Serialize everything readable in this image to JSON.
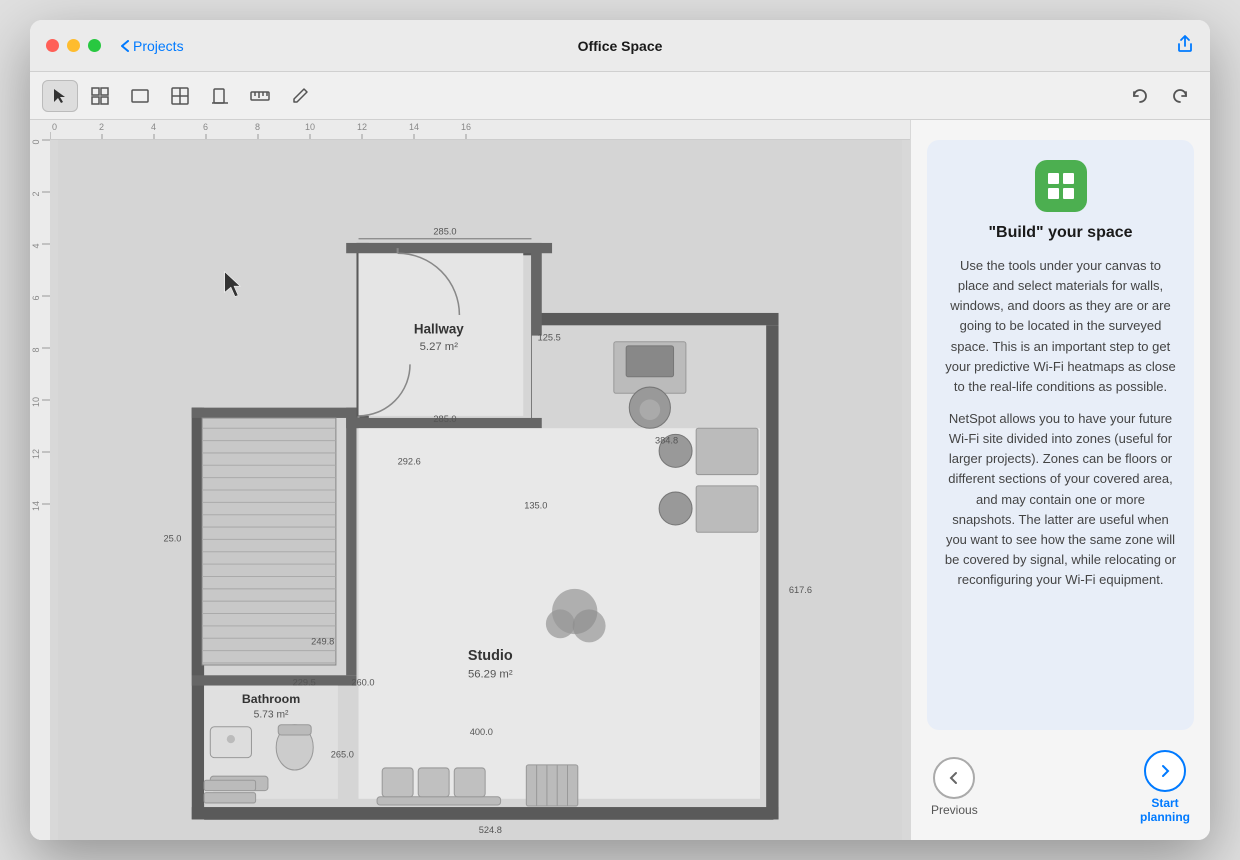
{
  "window": {
    "title": "Office Space",
    "nav_back_label": "Projects"
  },
  "toolbar": {
    "tools": [
      {
        "name": "select",
        "label": "▶",
        "active": true
      },
      {
        "name": "table-grid",
        "label": "⊞",
        "active": false
      },
      {
        "name": "rectangle",
        "label": "▭",
        "active": false
      },
      {
        "name": "window-icon",
        "label": "⧉",
        "active": false
      },
      {
        "name": "door-icon",
        "label": "⊓",
        "active": false
      },
      {
        "name": "ruler-icon",
        "label": "≡",
        "active": false
      },
      {
        "name": "pencil-icon",
        "label": "✏",
        "active": false
      }
    ],
    "undo_label": "↩",
    "redo_label": "↪"
  },
  "canvas": {
    "ruler_marks": [
      "0",
      "2",
      "4",
      "6",
      "8",
      "10",
      "12",
      "14",
      "16"
    ],
    "rooms": [
      {
        "name": "Hallway",
        "area": "5.27 m²"
      },
      {
        "name": "Studio",
        "area": "56.29 m²"
      },
      {
        "name": "Bathroom",
        "area": "5.73 m²"
      }
    ]
  },
  "right_panel": {
    "icon_label": "build-icon",
    "card_title": "\"Build\" your space",
    "paragraph1": "Use the tools under your canvas to place and select materials for walls, windows, and doors as they are or are going to be located in the surveyed space. This is an important step to get your predictive Wi-Fi heatmaps as close to the real-life conditions as possible.",
    "paragraph2": "NetSpot allows you to have your future Wi-Fi site divided into zones (useful for larger projects). Zones can be floors or different sections of your covered area, and may contain one or more snapshots. The latter are useful when you want to see how the same zone will be covered by signal, while relocating or reconfiguring your Wi-Fi equipment.",
    "prev_label": "Previous",
    "start_label": "Start\nplanning"
  }
}
